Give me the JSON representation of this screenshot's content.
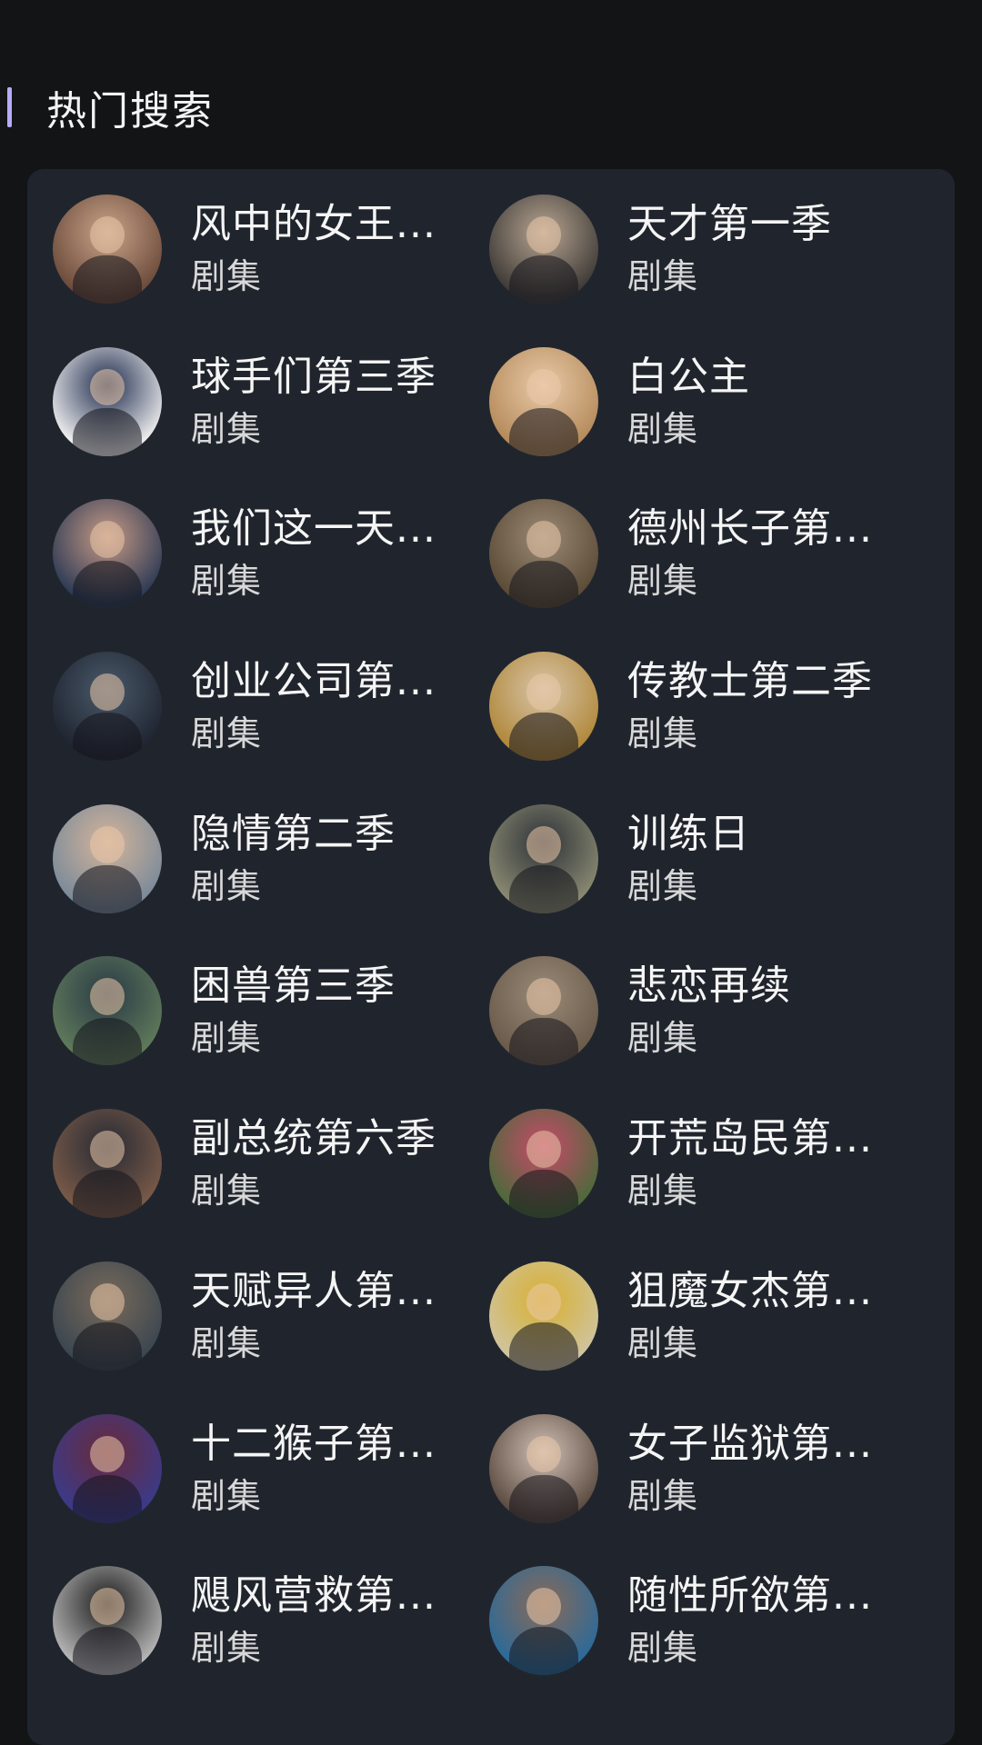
{
  "header": {
    "title": "热门搜索"
  },
  "items": [
    {
      "title": "风中的女王...",
      "type": "剧集",
      "thumb_colors": [
        "#6b4a3a",
        "#c9a48a"
      ]
    },
    {
      "title": "天才第一季",
      "type": "剧集",
      "thumb_colors": [
        "#3d3a36",
        "#b8a592"
      ]
    },
    {
      "title": "球手们第三季",
      "type": "剧集",
      "thumb_colors": [
        "#f0f0f0",
        "#1d2a4c"
      ]
    },
    {
      "title": "白公主",
      "type": "剧集",
      "thumb_colors": [
        "#b48a5a",
        "#e9c9a8"
      ]
    },
    {
      "title": "我们这一天...",
      "type": "剧集",
      "thumb_colors": [
        "#2c3a55",
        "#c79a85"
      ]
    },
    {
      "title": "德州长子第...",
      "type": "剧集",
      "thumb_colors": [
        "#5a4a36",
        "#9a8a76"
      ]
    },
    {
      "title": "创业公司第...",
      "type": "剧集",
      "thumb_colors": [
        "#1f2430",
        "#4a5a6a"
      ]
    },
    {
      "title": "传教士第二季",
      "type": "剧集",
      "thumb_colors": [
        "#b0883a",
        "#d8c4a8"
      ]
    },
    {
      "title": "隐情第二季",
      "type": "剧集",
      "thumb_colors": [
        "#7a8a9a",
        "#d4b49a"
      ]
    },
    {
      "title": "训练日",
      "type": "剧集",
      "thumb_colors": [
        "#8a8a72",
        "#2e3238"
      ]
    },
    {
      "title": "困兽第三季",
      "type": "剧集",
      "thumb_colors": [
        "#5f7a5a",
        "#2a3a46"
      ]
    },
    {
      "title": "悲恋再续",
      "type": "剧集",
      "thumb_colors": [
        "#6a5a4a",
        "#9a8a78"
      ]
    },
    {
      "title": "副总统第六季",
      "type": "剧集",
      "thumb_colors": [
        "#7a5a48",
        "#262a34"
      ]
    },
    {
      "title": "开荒岛民第...",
      "type": "剧集",
      "thumb_colors": [
        "#4a6a3a",
        "#c84a6a"
      ]
    },
    {
      "title": "天赋异人第...",
      "type": "剧集",
      "thumb_colors": [
        "#3a4650",
        "#7a6a5a"
      ]
    },
    {
      "title": "狙魔女杰第...",
      "type": "剧集",
      "thumb_colors": [
        "#cfc4a0",
        "#d8b030"
      ]
    },
    {
      "title": "十二猴子第...",
      "type": "剧集",
      "thumb_colors": [
        "#3a3a8a",
        "#6a2a3a"
      ]
    },
    {
      "title": "女子监狱第...",
      "type": "剧集",
      "thumb_colors": [
        "#5a4a40",
        "#d0c0b4"
      ]
    },
    {
      "title": "飓风营救第...",
      "type": "剧集",
      "thumb_colors": [
        "#b8b8b8",
        "#1a1a1a"
      ]
    },
    {
      "title": "随性所欲第...",
      "type": "剧集",
      "thumb_colors": [
        "#2a6a9a",
        "#8a6a58"
      ]
    }
  ]
}
